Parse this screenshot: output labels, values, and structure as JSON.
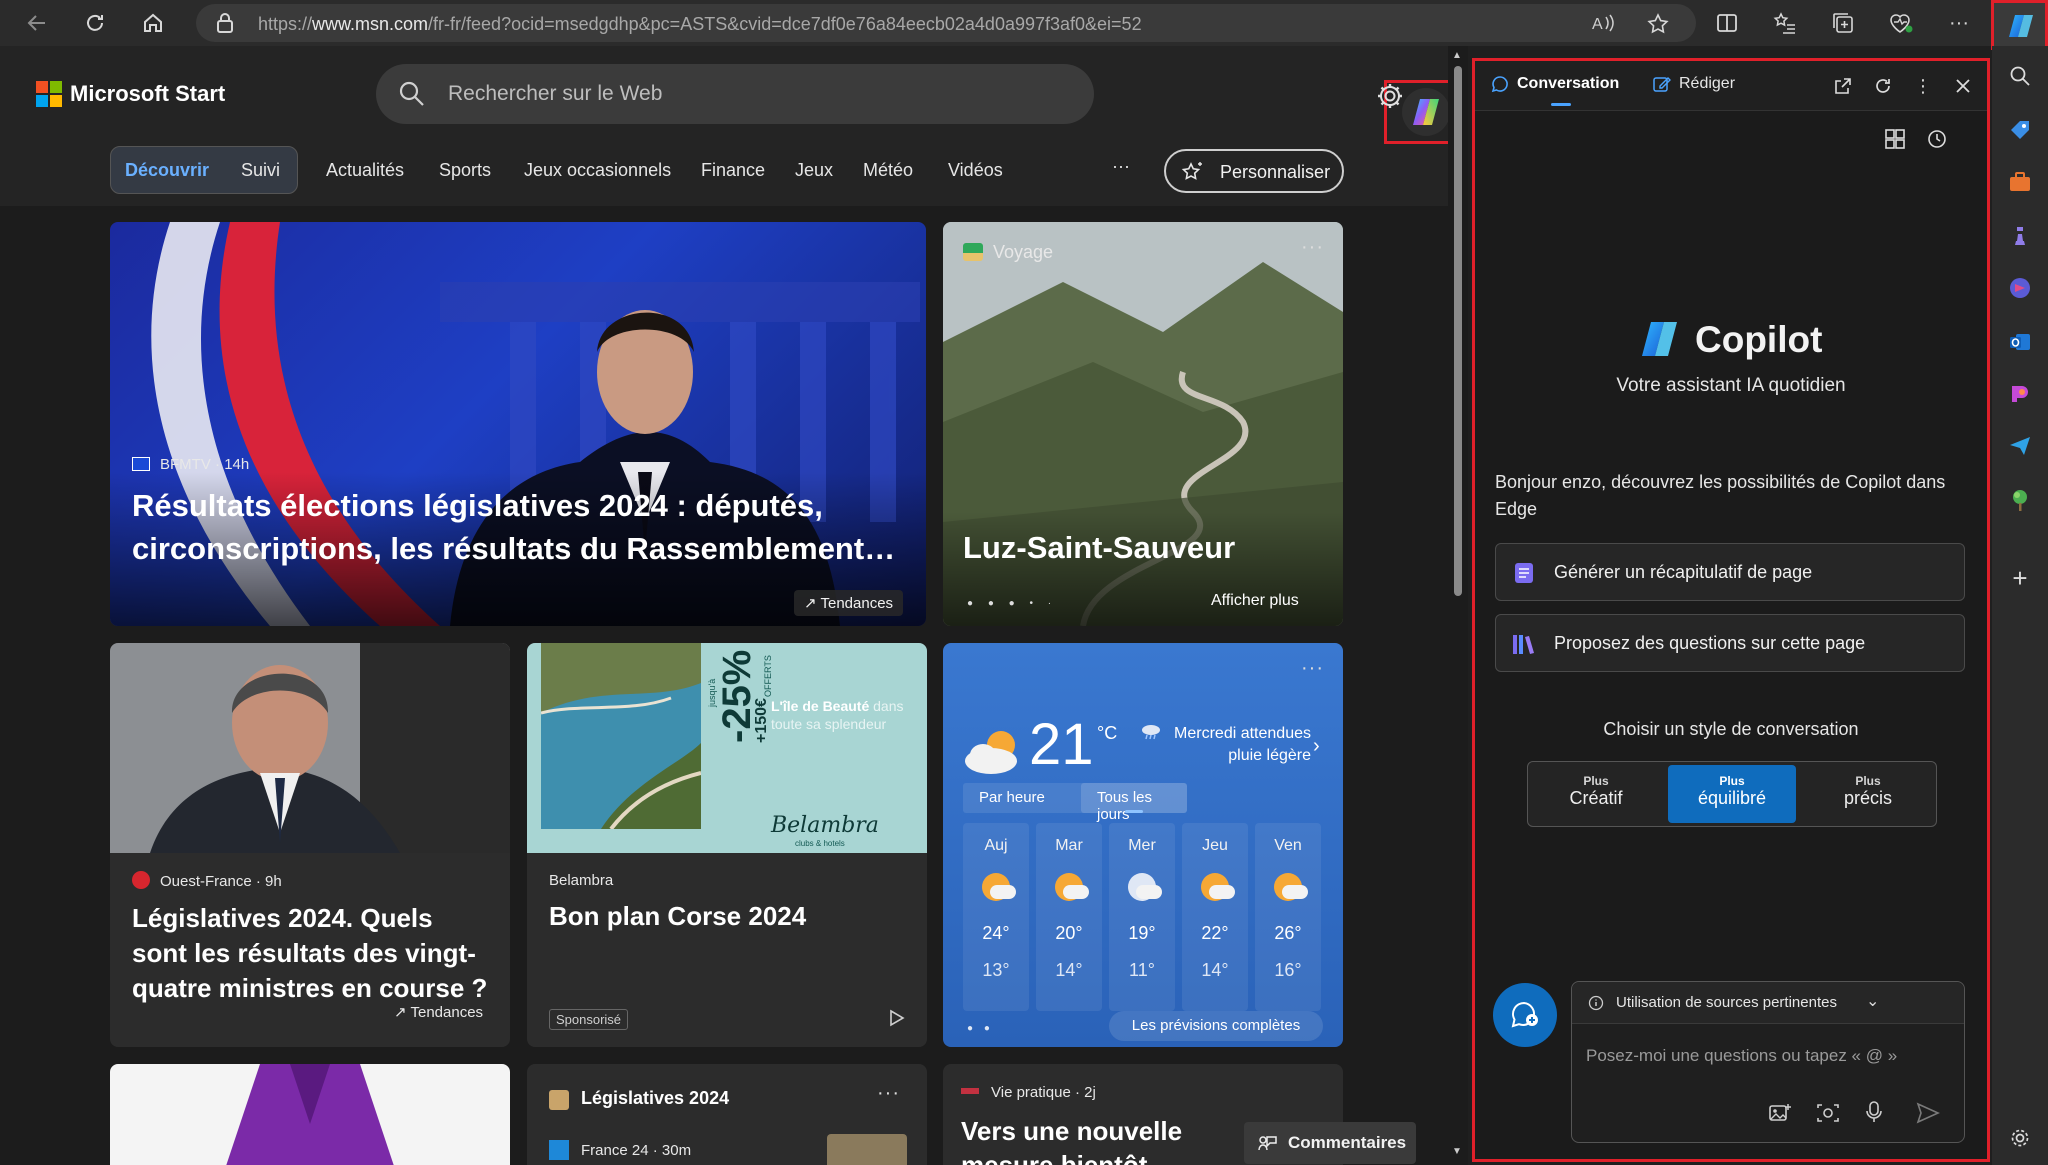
{
  "browser": {
    "url_prefix": "https://",
    "url_host": "www.msn.com",
    "url_path": "/fr-fr/feed?ocid=msedgdhp&pc=ASTS&cvid=dce7df0e76a84eecb02a4d0a997f3af0&ei=52"
  },
  "msn": {
    "brand": "Microsoft Start",
    "search_placeholder": "Rechercher sur le Web",
    "nav": {
      "discover": "Découvrir",
      "following": "Suivi",
      "items": [
        "Actualités",
        "Sports",
        "Jeux occasionnels",
        "Finance",
        "Jeux",
        "Météo",
        "Vidéos"
      ],
      "more": "···",
      "personalize": "Personnaliser"
    },
    "hero": {
      "source": "BFMTV",
      "age": "14h",
      "title": "Résultats élections législatives 2024 : députés, circonscriptions, les résultats du Rassemblement…",
      "badge": "Tendances"
    },
    "travel": {
      "category": "Voyage",
      "title": "Luz-Saint-Sauveur",
      "more": "Afficher plus"
    },
    "news2": {
      "source": "Ouest-France",
      "age": "9h",
      "title": "Législatives 2024. Quels sont les résultats des vingt-quatre ministres en course ?",
      "badge": "Tendances"
    },
    "ad": {
      "discount": "-25%",
      "discount_note": "jusqu'à",
      "bonus": "+150€",
      "bonus_note": "OFFERTS",
      "tagline_strong": "L'île de Beauté",
      "tagline_rest": "dans toute sa splendeur",
      "logo": "Belambra",
      "logo_sub": "clubs & hotels",
      "source": "Belambra",
      "title": "Bon plan Corse 2024",
      "sponsored": "Sponsorisé"
    },
    "weather": {
      "temp": "21",
      "unit": "°C",
      "forecast_text": "Mercredi attendues pluie légère",
      "tab_hourly": "Par heure",
      "tab_daily": "Tous les jours",
      "days": [
        {
          "name": "Auj",
          "hi": "24°",
          "lo": "13°"
        },
        {
          "name": "Mar",
          "hi": "20°",
          "lo": "14°"
        },
        {
          "name": "Mer",
          "hi": "19°",
          "lo": "11°"
        },
        {
          "name": "Jeu",
          "hi": "22°",
          "lo": "14°"
        },
        {
          "name": "Ven",
          "hi": "26°",
          "lo": "16°"
        }
      ],
      "full_link": "Les prévisions complètes"
    },
    "bottom": {
      "topic": "Législatives 2024",
      "topic_source": "France 24",
      "topic_age": "30m",
      "vie_category": "Vie pratique",
      "vie_age": "2j",
      "vie_title": "Vers une nouvelle mesure bientôt",
      "comments": "Commentaires"
    }
  },
  "copilot": {
    "tab_chat": "Conversation",
    "tab_compose": "Rédiger",
    "name": "Copilot",
    "subtitle": "Votre assistant IA quotidien",
    "greeting": "Bonjour enzo, découvrez les possibilités de Copilot dans Edge",
    "suggestions": [
      "Générer un récapitulatif de page",
      "Proposez des questions sur cette page"
    ],
    "style_heading": "Choisir un style de conversation",
    "styles": [
      {
        "small": "Plus",
        "label": "Créatif"
      },
      {
        "small": "Plus",
        "label": "équilibré"
      },
      {
        "small": "Plus",
        "label": "précis"
      }
    ],
    "sources_label": "Utilisation de sources pertinentes",
    "input_placeholder": "Posez-moi une questions ou tapez « @ »"
  },
  "colors": {
    "accent": "#0f6cbd",
    "highlight": "#e0202a",
    "weather_bg": "#2f6fc7"
  }
}
